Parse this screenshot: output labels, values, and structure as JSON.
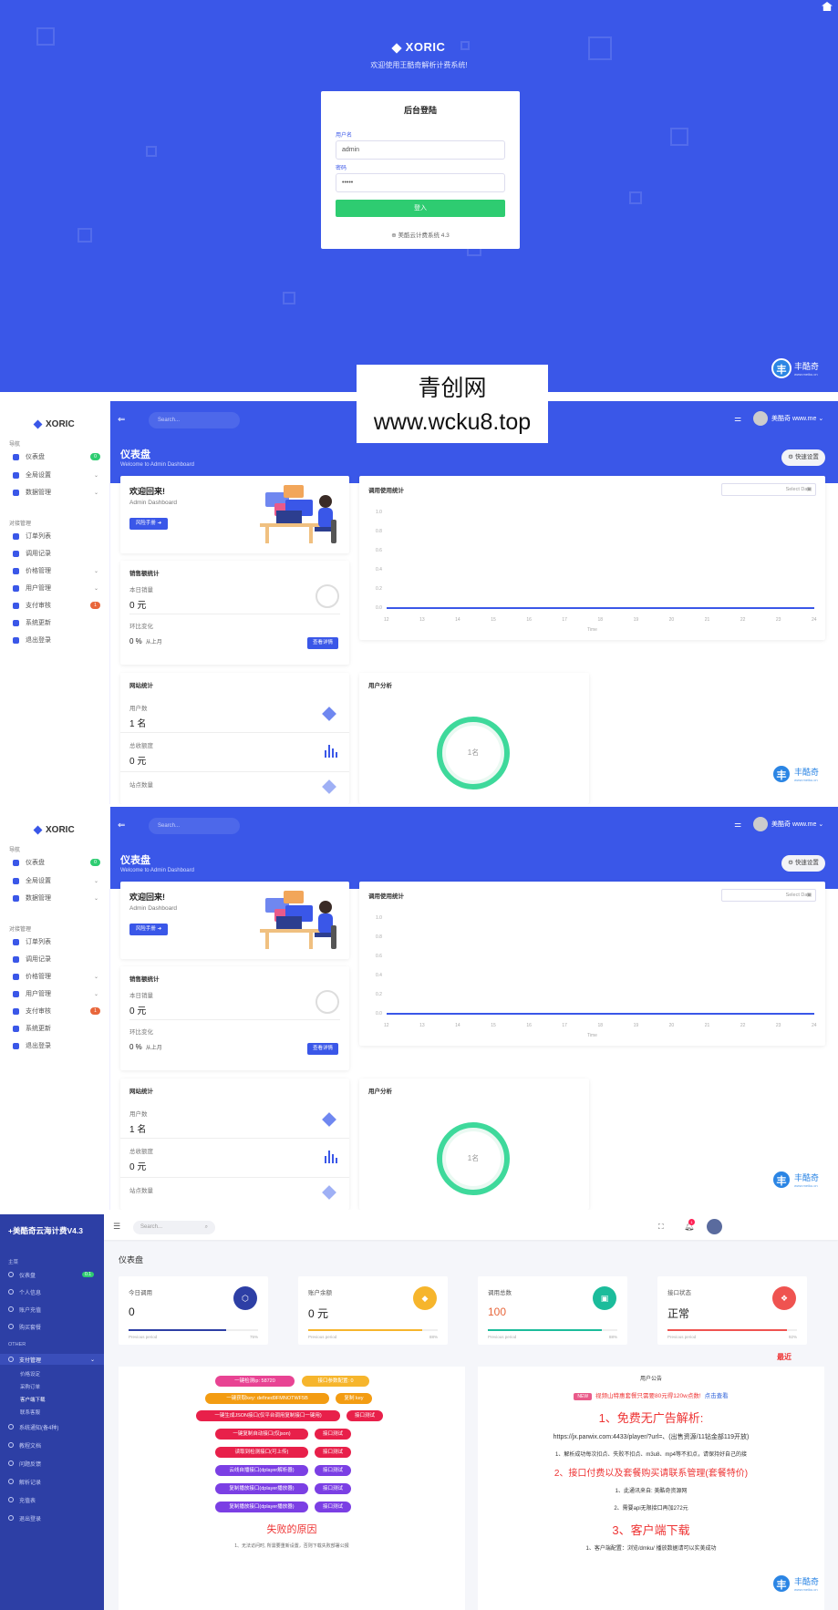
{
  "login": {
    "brand": "XORIC",
    "welcome": "欢迎使用王酷奇解析计费系统!",
    "card_title": "后台登陆",
    "username_label": "用户名",
    "username_value": "admin",
    "password_label": "密码",
    "password_value": "•••••",
    "login_button": "登入",
    "footer": "美酷云计费系统 4.3"
  },
  "watermark": {
    "line1": "青创网",
    "line2": "www.wcku8.top"
  },
  "site_badge": {
    "name": "丰酷奇",
    "url": "www.meiku.cn",
    "glyph": "丰"
  },
  "dashboard": {
    "brand": "XORIC",
    "search_placeholder": "Search...",
    "user": "美酷奇 www.me",
    "title": "仪表盘",
    "subtitle": "Welcome to Admin Dashboard",
    "quick_button": "快速设置",
    "nav_header_1": "导航",
    "nav_header_2": "对接管理",
    "nav": [
      {
        "label": "仪表盘",
        "badge": "0"
      },
      {
        "label": "全局设置",
        "chev": "⌄"
      },
      {
        "label": "数据管理",
        "chev": "⌄"
      },
      {
        "label": "订单列表"
      },
      {
        "label": "调用记录"
      },
      {
        "label": "价格管理",
        "chev": "⌄"
      },
      {
        "label": "用户管理",
        "chev": "⌄"
      },
      {
        "label": "支付审核",
        "badge": "1"
      },
      {
        "label": "系统更新"
      },
      {
        "label": "退出登录"
      }
    ],
    "welcome_title": "欢迎回来!",
    "welcome_sub": "Admin Dashboard",
    "welcome_button": "风险手册 ➜",
    "chart_title": "调用使用统计",
    "date_placeholder": "Select Date",
    "sales_title": "销售额统计",
    "today_label": "本日销量",
    "today_value": "0 元",
    "compare_label": "环比变化",
    "compare_value": "0 %",
    "compare_sub": "从上月",
    "view_button": "查看详情",
    "site_title": "网站统计",
    "users_label": "用户数",
    "users_value": "1 名",
    "orders_label": "总收额度",
    "orders_value": "0 元",
    "third_label": "站点数量",
    "user_analysis": "用户分析",
    "donut_label": "1名",
    "chart_data": {
      "type": "line",
      "x": [
        12,
        13,
        14,
        15,
        16,
        17,
        18,
        19,
        20,
        21,
        22,
        23,
        24
      ],
      "y": [
        0,
        0,
        0,
        0,
        0,
        0,
        0,
        0,
        0,
        0,
        0,
        0,
        0
      ],
      "yticks": [
        "1.0",
        "0.8",
        "0.6",
        "0.4",
        "0.2",
        "0.0"
      ],
      "xlabel": "Time",
      "ylim": [
        0,
        1
      ]
    }
  },
  "dashboard2": {
    "user": "美酷奇 www.me",
    "nav_header_1": "导航"
  },
  "meiku": {
    "title": "+美酷奇云海计费V4.3",
    "search_placeholder": "Search...",
    "bell_count": "1",
    "page_title": "仪表盘",
    "nav_header_main": "主菜",
    "nav_header_other": "OTHER",
    "nav": [
      {
        "label": "仪表盘",
        "badge": "0.1"
      },
      {
        "label": "个人信息"
      },
      {
        "label": "账户充值"
      },
      {
        "label": "购买套餐"
      }
    ],
    "nav_active": "支付管理",
    "sub": [
      "价格设定",
      "采购订单",
      "客户端下载",
      "联系客服"
    ],
    "nav_rest": [
      "系统通知(备4种)",
      "教程文档",
      "问题反馈",
      "解析记录",
      "充值表",
      "退出登录"
    ],
    "stats": [
      {
        "label": "今日调用",
        "value": "0",
        "color": "#2d3fa5",
        "icon": "⬡",
        "pct": "75%",
        "fill": 0.75
      },
      {
        "label": "账户余额",
        "value": "0 元",
        "color": "#f6b52c",
        "icon": "◆",
        "pct": "88%",
        "fill": 0.88
      },
      {
        "label": "调用总数",
        "value": "100",
        "color": "#1bbc9b",
        "icon": "▣",
        "pct": "88%",
        "fill": 0.88
      },
      {
        "label": "接口状态",
        "value": "正常",
        "color": "#ef5350",
        "icon": "❖",
        "pct": "92%",
        "fill": 0.92
      }
    ],
    "previous": "Previous period",
    "recent": "最近",
    "pills": [
      {
        "text": "一键检测ip: 58720",
        "color": "#e84393"
      },
      {
        "text": "接口参数配置: 0",
        "color": "#f6b52c"
      },
      {
        "text": "一键获取key: defined9FMNOTWF5B",
        "color": "#f39c12"
      },
      {
        "text": "复制 key",
        "color": "#f39c12"
      },
      {
        "text": "一键生成JSON接口(仅平台调用复制接口一键用)",
        "color": "#e8204a"
      },
      {
        "text": "接口测试",
        "color": "#e8204a"
      },
      {
        "text": "一键复制自动接口(仅json)",
        "color": "#e8204a"
      },
      {
        "text": "接口测试",
        "color": "#e8204a"
      },
      {
        "text": "读取到检测接口(可上传)",
        "color": "#e8204a"
      },
      {
        "text": "接口测试",
        "color": "#e8204a"
      },
      {
        "text": "云线自播接口(dplayer解析器)",
        "color": "#7b3fe4"
      },
      {
        "text": "接口测试",
        "color": "#7b3fe4"
      },
      {
        "text": "复制播放接口(dplayer播放器)",
        "color": "#7b3fe4"
      },
      {
        "text": "接口测试",
        "color": "#7b3fe4"
      },
      {
        "text": "复制播放接口(dplayer播放器)",
        "color": "#7b3fe4"
      },
      {
        "text": "接口测试",
        "color": "#7b3fe4"
      }
    ],
    "fail_title": "失败的原因",
    "fail_text": "1、无法访问时, 所需要重新设置，否则下载失败部署公报",
    "ann_title": "用户公告",
    "new_tag": "NEW",
    "new_text": "视频山特惠套餐只需要80元得120w点数!",
    "new_link": "点击查看",
    "h1": "1、免费无广告解析:",
    "url": "https://jx.parwix.com:4433/player/?url=、(出售资源/11钻金部119开放)",
    "t1": "1、解析成功每次扣点、失败不扣点、m3u8、mp4等不扣点，请保持好自己的接",
    "h2": "2、接口付费以及套餐购买请联系管理(套餐特价)",
    "t2": "1、此通讯来自: 美酷奇资源网",
    "t3": "2、需要api无限接口再加272元",
    "h3": "3、客户端下载",
    "t4": "1、客户端配置：浏览/dmku/ 播放数据请可以实美成功"
  }
}
